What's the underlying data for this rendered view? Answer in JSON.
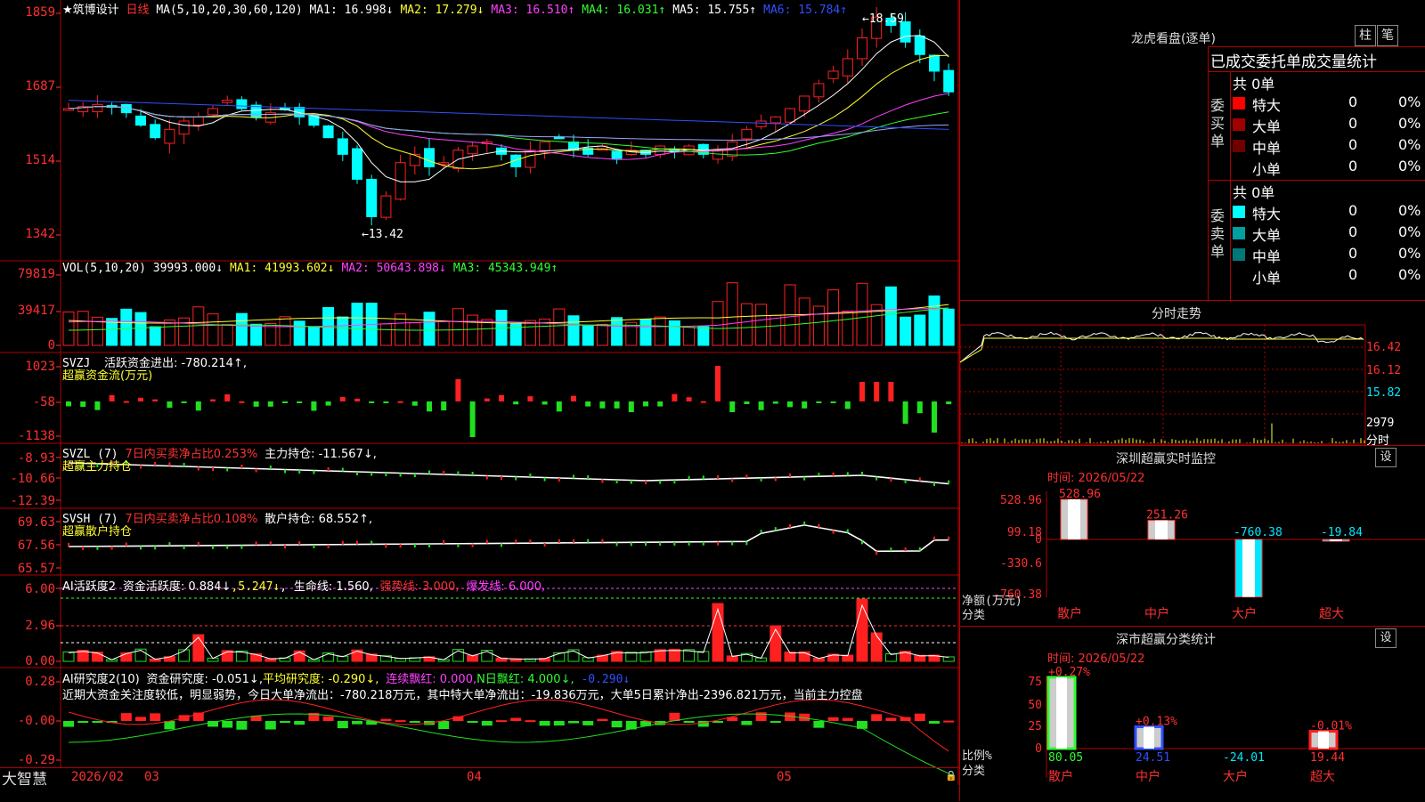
{
  "app": {
    "name": "大智慧",
    "stock_title": "★筑博设计",
    "period": "日线"
  },
  "main": {
    "ma_label": "MA(5,10,20,30,60,120)",
    "ma_items": [
      {
        "text": "MA1: 16.998↓",
        "color": "#ffffff"
      },
      {
        "text": "MA2: 17.279↓",
        "color": "#ffff30"
      },
      {
        "text": "MA3: 16.510↑",
        "color": "#ff40ff"
      },
      {
        "text": "MA4: 16.031↑",
        "color": "#30ff30"
      },
      {
        "text": "MA5: 15.755↑",
        "color": "#ffffff"
      },
      {
        "text": "MA6: 15.784↑",
        "color": "#3050ff"
      }
    ],
    "axis": [
      "1859",
      "1687",
      "1514",
      "1342"
    ],
    "high_label": "18.59",
    "low_label": "13.42"
  },
  "vol": {
    "label": "VOL(5,10,20)",
    "items": [
      {
        "text": "39993.000↓",
        "color": "#ffffff"
      },
      {
        "text": "MA1: 41993.602↓",
        "color": "#ffff30"
      },
      {
        "text": "MA2: 50643.898↓",
        "color": "#ff40ff"
      },
      {
        "text": "MA3: 45343.949↑",
        "color": "#30ff30"
      }
    ],
    "axis": [
      "79819",
      "39417",
      "0"
    ]
  },
  "svzj": {
    "label": "SVZJ",
    "l1": "活跃资金进出: -780.214↑,",
    "l2": "超赢资金流(万元)",
    "axis": [
      "1023",
      "-58",
      "-1138"
    ]
  },
  "svzl": {
    "label": "SVZL (7)",
    "red": "7日内买卖净占比0.253%",
    "w": "主力持仓: -11.567↓,",
    "l2": "超赢主力持仓",
    "axis": [
      "-8.93",
      "-10.66",
      "-12.39"
    ]
  },
  "svsh": {
    "label": "SVSH (7)",
    "red": "7日内买卖净占比0.108%",
    "w": "散户持仓: 68.552↑,",
    "l2": "超赢散户持仓",
    "axis": [
      "69.63",
      "67.56",
      "65.57"
    ]
  },
  "ai1": {
    "label": "AI活跃度2",
    "w1": "资金活跃度: 0.884↓",
    "y1": "5.247↓",
    "w2": "生命线: 1.560,",
    "r1": "强势线: 3.000,",
    "m1": "爆发线: 6.000,",
    "axis": [
      "6.00",
      "2.96",
      "0.00"
    ]
  },
  "ai2": {
    "label": "AI研究度2(10)",
    "w1": "资金研究度: -0.051↓,",
    "y1": "平均研究度: -0.290↓,",
    "m1": "连续飘红: 0.000,",
    "g1": "N日飘红: 4.000↓,",
    "b1": "-0.290↓",
    "comment": "近期大资金关注度较低，明显弱势，今日大单净流出：-780.218万元，其中特大单净流出：-19.836万元，大单5日累计净出-2396.821万元，当前主力控盘",
    "axis": [
      "0.28",
      "-0.00",
      "-0.29"
    ]
  },
  "xaxis": [
    "2026/02",
    "03",
    "04",
    "05"
  ],
  "right": {
    "lhkp": {
      "title": "龙虎看盘(逐单)",
      "btn_a": "柱",
      "btn_b": "笔",
      "header": "已成交委托单成交量统计",
      "buy": {
        "side": "委买单",
        "total": "共 0单",
        "rows": [
          {
            "name": "特大",
            "color": "#ff0000",
            "v": "0",
            "p": "0%"
          },
          {
            "name": "大单",
            "color": "#a00000",
            "v": "0",
            "p": "0%"
          },
          {
            "name": "中单",
            "color": "#700000",
            "v": "0",
            "p": "0%"
          },
          {
            "name": "小单",
            "color": "",
            "v": "0",
            "p": "0%"
          }
        ]
      },
      "sell": {
        "side": "委卖单",
        "total": "共 0单",
        "rows": [
          {
            "name": "特大",
            "color": "#00ffff",
            "v": "0",
            "p": "0%"
          },
          {
            "name": "大单",
            "color": "#00a0a0",
            "v": "0",
            "p": "0%"
          },
          {
            "name": "中单",
            "color": "#007878",
            "v": "0",
            "p": "0%"
          },
          {
            "name": "小单",
            "color": "",
            "v": "0",
            "p": "0%"
          }
        ]
      }
    },
    "fenshi": {
      "title": "分时走势",
      "axis": [
        "16.42",
        "16.12",
        "15.82",
        "2979",
        "分时"
      ]
    },
    "szcy": {
      "title": "深圳超赢实时监控",
      "btn": "设",
      "time": "时间: 2026/05/22",
      "axis": [
        "528.96",
        "99.18",
        "0",
        "-330.6",
        "-760.38"
      ],
      "unit": "净额(万元)",
      "cat_label": "分类",
      "bars": [
        {
          "cat": "散户",
          "value": 528.96,
          "label": "528.96"
        },
        {
          "cat": "中户",
          "value": 251.26,
          "label": "251.26"
        },
        {
          "cat": "大户",
          "value": -760.38,
          "label": "-760.38"
        },
        {
          "cat": "超大",
          "value": -19.84,
          "label": "-19.84"
        }
      ]
    },
    "fltj": {
      "title": "深市超赢分类统计",
      "btn": "设",
      "time": "时间: 2026/05/22",
      "axis": [
        "75",
        "50",
        "25",
        "0"
      ],
      "unit": "比例%",
      "cat_label": "分类",
      "bars": [
        {
          "cat": "散户",
          "value": 80.05,
          "label": "80.05",
          "pct": "+0.27%"
        },
        {
          "cat": "中户",
          "value": 24.51,
          "label": "24.51",
          "pct": "+0.13%"
        },
        {
          "cat": "大户",
          "value": -24.01,
          "label": "-24.01",
          "pct": ""
        },
        {
          "cat": "超大",
          "value": 19.44,
          "label": "19.44",
          "pct": "-0.01%"
        }
      ]
    }
  },
  "colors": {
    "up": "#ff2020",
    "down": "#00ffff",
    "grid": "#b00000"
  }
}
